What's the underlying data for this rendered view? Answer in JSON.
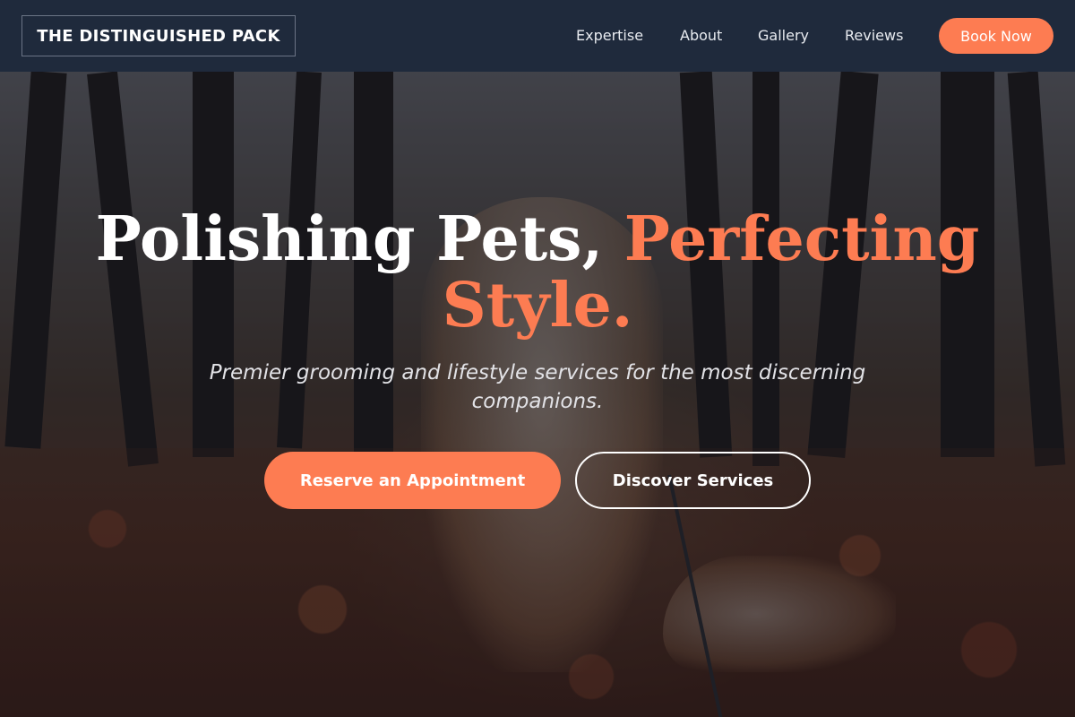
{
  "header": {
    "logo": "THE DISTINGUISHED PACK",
    "nav": [
      "Expertise",
      "About",
      "Gallery",
      "Reviews"
    ],
    "cta": "Book Now"
  },
  "hero": {
    "headline_main": "Polishing Pets, ",
    "headline_accent": "Perfecting Style.",
    "subtitle": "Premier grooming and lifestyle services for the most discerning companions.",
    "primary_button": "Reserve an Appointment",
    "secondary_button": "Discover Services",
    "background_image": "dog-in-autumn-forest"
  },
  "colors": {
    "accent": "#fd7c52",
    "header_bg": "#1f2a3c"
  }
}
